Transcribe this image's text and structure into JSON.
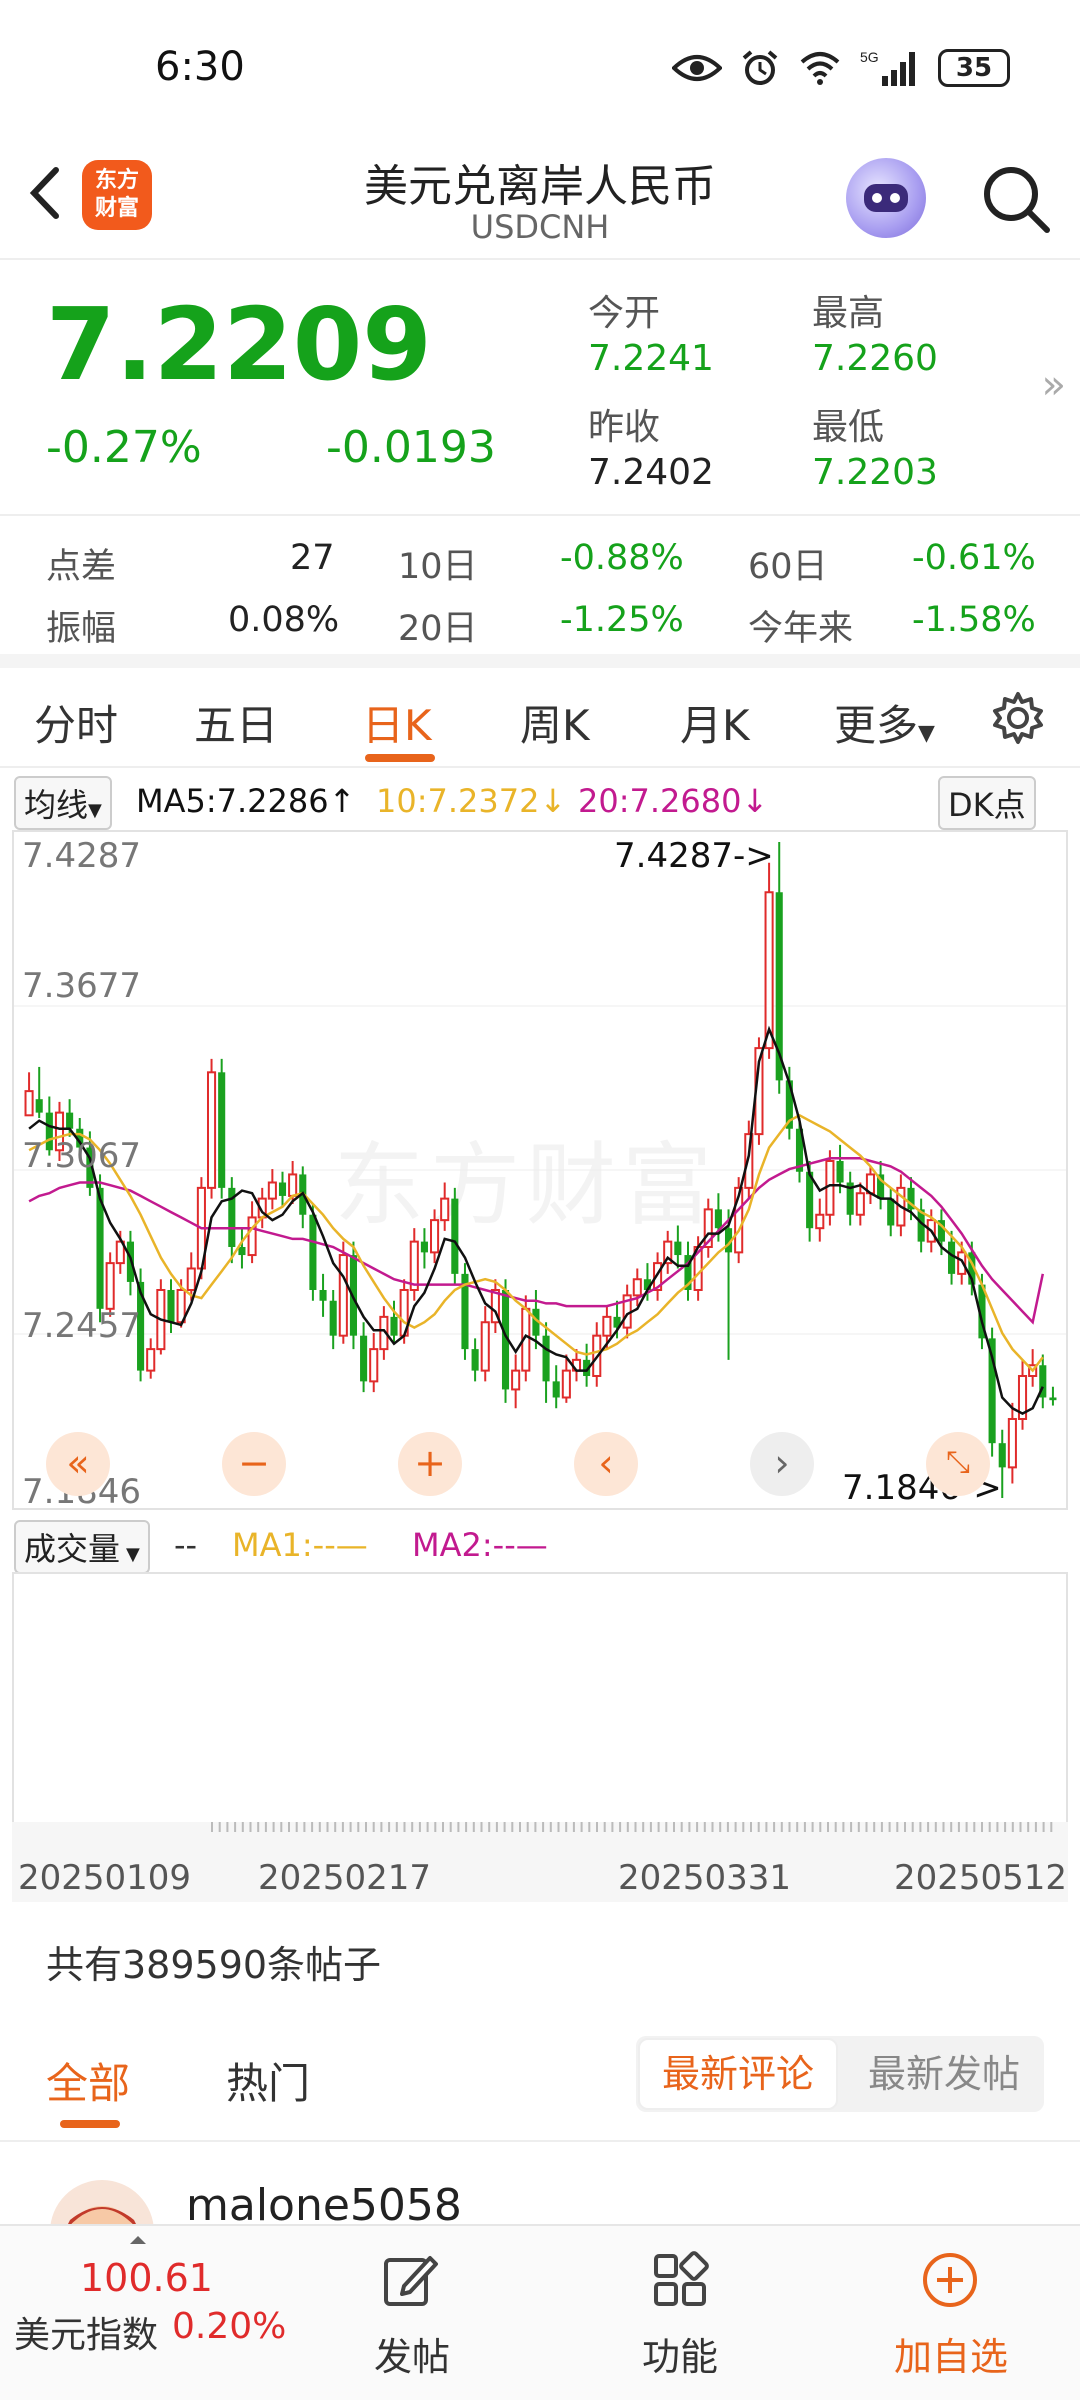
{
  "status": {
    "time": "6:30",
    "battery": "35",
    "network": "5G"
  },
  "header": {
    "title": "美元兑离岸人民币",
    "code": "USDCNH",
    "logo": [
      "东方",
      "财富"
    ]
  },
  "quote": {
    "price": "7.2209",
    "change_pct": "-0.27%",
    "change": "-0.0193",
    "open_label": "今开",
    "open": "7.2241",
    "high_label": "最高",
    "high": "7.2260",
    "prev_close_label": "昨收",
    "prev_close": "7.2402",
    "low_label": "最低",
    "low": "7.2203"
  },
  "stats": {
    "spread_label": "点差",
    "spread": "27",
    "amplitude_label": "振幅",
    "amplitude": "0.08%",
    "d10_label": "10日",
    "d10": "-0.88%",
    "d20_label": "20日",
    "d20": "-1.25%",
    "d60_label": "60日",
    "d60": "-0.61%",
    "ytd_label": "今年来",
    "ytd": "-1.58%"
  },
  "tabs": [
    "分时",
    "五日",
    "日K",
    "周K",
    "月K",
    "更多"
  ],
  "active_tab": "日K",
  "indicator": {
    "selector": "均线",
    "ma5": "MA5:7.2286↑",
    "ma10": "10:7.2372↓",
    "ma20": "20:7.2680↓",
    "dk": "DK点"
  },
  "chart_data": {
    "type": "candlestick",
    "y_ticks": [
      "7.4287",
      "7.3677",
      "7.3067",
      "7.2457",
      "7.1846"
    ],
    "ylim": [
      7.1846,
      7.4287
    ],
    "high_marker": "7.4287->",
    "low_marker": "7.1846->",
    "x_ticks": [
      "20250109",
      "20250217",
      "20250331",
      "20250512"
    ],
    "colors": {
      "up": "#e02b2b",
      "down": "#1aa11f",
      "ma5": "#111111",
      "ma10": "#e9b429",
      "ma20": "#c21a8f"
    },
    "watermark": "东方财富",
    "candles": [
      [
        7.327,
        7.336,
        7.333,
        7.343
      ],
      [
        7.333,
        7.328,
        7.326,
        7.345
      ],
      [
        7.328,
        7.314,
        7.312,
        7.334
      ],
      [
        7.314,
        7.328,
        7.31,
        7.332
      ],
      [
        7.328,
        7.322,
        7.319,
        7.333
      ],
      [
        7.322,
        7.315,
        7.312,
        7.326
      ],
      [
        7.315,
        7.3,
        7.297,
        7.321
      ],
      [
        7.3,
        7.255,
        7.25,
        7.305
      ],
      [
        7.255,
        7.272,
        7.252,
        7.276
      ],
      [
        7.272,
        7.28,
        7.268,
        7.284
      ],
      [
        7.28,
        7.265,
        7.26,
        7.284
      ],
      [
        7.265,
        7.232,
        7.228,
        7.27
      ],
      [
        7.232,
        7.24,
        7.229,
        7.244
      ],
      [
        7.24,
        7.262,
        7.238,
        7.266
      ],
      [
        7.262,
        7.25,
        7.246,
        7.266
      ],
      [
        7.25,
        7.262,
        7.248,
        7.266
      ],
      [
        7.262,
        7.27,
        7.258,
        7.276
      ],
      [
        7.27,
        7.3,
        7.266,
        7.304
      ],
      [
        7.3,
        7.343,
        7.296,
        7.348
      ],
      [
        7.343,
        7.3,
        7.296,
        7.348
      ],
      [
        7.3,
        7.278,
        7.272,
        7.304
      ],
      [
        7.278,
        7.275,
        7.27,
        7.285
      ],
      [
        7.275,
        7.289,
        7.272,
        7.295
      ],
      [
        7.289,
        7.296,
        7.285,
        7.3
      ],
      [
        7.296,
        7.302,
        7.292,
        7.307
      ],
      [
        7.302,
        7.297,
        7.293,
        7.306
      ],
      [
        7.297,
        7.305,
        7.294,
        7.31
      ],
      [
        7.305,
        7.29,
        7.285,
        7.308
      ],
      [
        7.29,
        7.262,
        7.258,
        7.294
      ],
      [
        7.262,
        7.258,
        7.252,
        7.268
      ],
      [
        7.258,
        7.245,
        7.24,
        7.262
      ],
      [
        7.245,
        7.275,
        7.242,
        7.28
      ],
      [
        7.275,
        7.245,
        7.24,
        7.28
      ],
      [
        7.245,
        7.228,
        7.224,
        7.25
      ],
      [
        7.228,
        7.24,
        7.224,
        7.246
      ],
      [
        7.24,
        7.252,
        7.236,
        7.256
      ],
      [
        7.252,
        7.245,
        7.242,
        7.258
      ],
      [
        7.245,
        7.262,
        7.242,
        7.266
      ],
      [
        7.262,
        7.28,
        7.258,
        7.285
      ],
      [
        7.28,
        7.276,
        7.27,
        7.285
      ],
      [
        7.276,
        7.288,
        7.272,
        7.292
      ],
      [
        7.288,
        7.296,
        7.284,
        7.302
      ],
      [
        7.296,
        7.268,
        7.264,
        7.3
      ],
      [
        7.268,
        7.24,
        7.236,
        7.272
      ],
      [
        7.24,
        7.232,
        7.228,
        7.244
      ],
      [
        7.232,
        7.25,
        7.228,
        7.256
      ],
      [
        7.25,
        7.262,
        7.246,
        7.266
      ],
      [
        7.262,
        7.225,
        7.22,
        7.266
      ],
      [
        7.225,
        7.232,
        7.218,
        7.238
      ],
      [
        7.232,
        7.255,
        7.228,
        7.26
      ],
      [
        7.255,
        7.245,
        7.24,
        7.262
      ],
      [
        7.245,
        7.228,
        7.22,
        7.25
      ],
      [
        7.228,
        7.222,
        7.218,
        7.234
      ],
      [
        7.222,
        7.232,
        7.22,
        7.238
      ],
      [
        7.232,
        7.236,
        7.228,
        7.24
      ],
      [
        7.236,
        7.23,
        7.226,
        7.242
      ],
      [
        7.23,
        7.245,
        7.226,
        7.25
      ],
      [
        7.245,
        7.252,
        7.24,
        7.256
      ],
      [
        7.252,
        7.248,
        7.244,
        7.258
      ],
      [
        7.248,
        7.26,
        7.244,
        7.264
      ],
      [
        7.26,
        7.266,
        7.256,
        7.27
      ],
      [
        7.266,
        7.262,
        7.258,
        7.272
      ],
      [
        7.262,
        7.272,
        7.258,
        7.276
      ],
      [
        7.272,
        7.28,
        7.268,
        7.284
      ],
      [
        7.28,
        7.275,
        7.27,
        7.286
      ],
      [
        7.275,
        7.262,
        7.258,
        7.28
      ],
      [
        7.262,
        7.278,
        7.258,
        7.282
      ],
      [
        7.278,
        7.292,
        7.274,
        7.296
      ],
      [
        7.292,
        7.285,
        7.28,
        7.298
      ],
      [
        7.285,
        7.276,
        7.236,
        7.292
      ],
      [
        7.276,
        7.3,
        7.272,
        7.304
      ],
      [
        7.3,
        7.32,
        7.296,
        7.325
      ],
      [
        7.32,
        7.352,
        7.316,
        7.356
      ],
      [
        7.352,
        7.41,
        7.348,
        7.421
      ],
      [
        7.41,
        7.34,
        7.335,
        7.4287
      ],
      [
        7.34,
        7.322,
        7.318,
        7.345
      ],
      [
        7.322,
        7.306,
        7.302,
        7.326
      ],
      [
        7.306,
        7.285,
        7.28,
        7.31
      ],
      [
        7.285,
        7.29,
        7.28,
        7.296
      ],
      [
        7.29,
        7.31,
        7.286,
        7.314
      ],
      [
        7.31,
        7.302,
        7.298,
        7.316
      ],
      [
        7.302,
        7.29,
        7.286,
        7.306
      ],
      [
        7.29,
        7.298,
        7.286,
        7.302
      ],
      [
        7.298,
        7.305,
        7.294,
        7.308
      ],
      [
        7.305,
        7.296,
        7.292,
        7.31
      ],
      [
        7.296,
        7.286,
        7.282,
        7.3
      ],
      [
        7.286,
        7.3,
        7.282,
        7.305
      ],
      [
        7.3,
        7.292,
        7.288,
        7.304
      ],
      [
        7.292,
        7.28,
        7.276,
        7.296
      ],
      [
        7.28,
        7.288,
        7.276,
        7.292
      ],
      [
        7.288,
        7.28,
        7.275,
        7.292
      ],
      [
        7.28,
        7.268,
        7.264,
        7.284
      ],
      [
        7.268,
        7.276,
        7.264,
        7.28
      ],
      [
        7.276,
        7.264,
        7.26,
        7.28
      ],
      [
        7.264,
        7.244,
        7.24,
        7.268
      ],
      [
        7.244,
        7.205,
        7.2,
        7.248
      ],
      [
        7.205,
        7.196,
        7.1846,
        7.21
      ],
      [
        7.196,
        7.214,
        7.19,
        7.22
      ],
      [
        7.214,
        7.23,
        7.21,
        7.236
      ],
      [
        7.23,
        7.234,
        7.226,
        7.24
      ],
      [
        7.234,
        7.222,
        7.218,
        7.238
      ],
      [
        7.222,
        7.221,
        7.219,
        7.226
      ]
    ],
    "ma5": [
      7.322,
      7.325,
      7.323,
      7.322,
      7.322,
      7.317,
      7.311,
      7.296,
      7.287,
      7.281,
      7.274,
      7.261,
      7.253,
      7.251,
      7.25,
      7.249,
      7.257,
      7.269,
      7.289,
      7.295,
      7.296,
      7.299,
      7.298,
      7.291,
      7.288,
      7.29,
      7.295,
      7.298,
      7.291,
      7.282,
      7.272,
      7.267,
      7.259,
      7.252,
      7.247,
      7.247,
      7.242,
      7.245,
      7.256,
      7.261,
      7.27,
      7.281,
      7.28,
      7.274,
      7.265,
      7.257,
      7.254,
      7.245,
      7.239,
      7.245,
      7.243,
      7.24,
      7.238,
      7.237,
      7.232,
      7.232,
      7.237,
      7.242,
      7.247,
      7.253,
      7.255,
      7.262,
      7.268,
      7.274,
      7.271,
      7.271,
      7.278,
      7.283,
      7.283,
      7.286,
      7.297,
      7.312,
      7.347,
      7.359,
      7.35,
      7.339,
      7.325,
      7.305,
      7.299,
      7.301,
      7.301,
      7.3,
      7.301,
      7.298,
      7.296,
      7.296,
      7.293,
      7.291,
      7.287,
      7.284,
      7.278,
      7.275,
      7.273,
      7.266,
      7.25,
      7.237,
      7.222,
      7.218,
      7.216,
      7.218,
      7.226
    ],
    "ma10": [
      7.314,
      7.316,
      7.318,
      7.319,
      7.32,
      7.32,
      7.318,
      7.314,
      7.309,
      7.303,
      7.297,
      7.29,
      7.282,
      7.274,
      7.268,
      7.263,
      7.26,
      7.259,
      7.264,
      7.269,
      7.274,
      7.28,
      7.285,
      7.289,
      7.291,
      7.293,
      7.297,
      7.298,
      7.294,
      7.29,
      7.285,
      7.281,
      7.278,
      7.271,
      7.265,
      7.259,
      7.254,
      7.25,
      7.248,
      7.25,
      7.253,
      7.258,
      7.262,
      7.264,
      7.265,
      7.266,
      7.265,
      7.262,
      7.258,
      7.255,
      7.251,
      7.248,
      7.245,
      7.242,
      7.239,
      7.238,
      7.239,
      7.24,
      7.242,
      7.245,
      7.247,
      7.25,
      7.253,
      7.257,
      7.261,
      7.264,
      7.268,
      7.272,
      7.276,
      7.279,
      7.284,
      7.292,
      7.305,
      7.315,
      7.32,
      7.325,
      7.327,
      7.325,
      7.323,
      7.321,
      7.318,
      7.315,
      7.312,
      7.308,
      7.303,
      7.3,
      7.297,
      7.294,
      7.291,
      7.289,
      7.286,
      7.282,
      7.278,
      7.272,
      7.264,
      7.255,
      7.246,
      7.24,
      7.236,
      7.232,
      7.237
    ],
    "ma20": [
      7.295,
      7.297,
      7.298,
      7.3,
      7.301,
      7.302,
      7.302,
      7.302,
      7.301,
      7.3,
      7.299,
      7.297,
      7.295,
      7.293,
      7.291,
      7.289,
      7.287,
      7.285,
      7.285,
      7.285,
      7.285,
      7.285,
      7.285,
      7.284,
      7.283,
      7.282,
      7.281,
      7.281,
      7.28,
      7.279,
      7.278,
      7.276,
      7.274,
      7.272,
      7.27,
      7.268,
      7.266,
      7.265,
      7.264,
      7.264,
      7.264,
      7.264,
      7.264,
      7.264,
      7.263,
      7.262,
      7.261,
      7.26,
      7.259,
      7.258,
      7.258,
      7.257,
      7.257,
      7.256,
      7.256,
      7.256,
      7.256,
      7.256,
      7.257,
      7.258,
      7.259,
      7.261,
      7.263,
      7.266,
      7.269,
      7.272,
      7.276,
      7.28,
      7.284,
      7.288,
      7.292,
      7.296,
      7.3,
      7.303,
      7.305,
      7.307,
      7.308,
      7.309,
      7.31,
      7.311,
      7.311,
      7.311,
      7.311,
      7.31,
      7.309,
      7.308,
      7.306,
      7.303,
      7.3,
      7.297,
      7.293,
      7.288,
      7.283,
      7.277,
      7.271,
      7.266,
      7.262,
      7.258,
      7.254,
      7.25,
      7.268
    ]
  },
  "volume": {
    "selector": "成交量",
    "value": "--",
    "ma1": "MA1:--",
    "ma2": "MA2:--"
  },
  "posts": {
    "count_text": "共有389590条帖子",
    "tabs": [
      "全部",
      "热门"
    ],
    "sort_active": "最新评论",
    "sort_other": "最新发帖",
    "first_user": "malone5058"
  },
  "bottom": {
    "index_value": "100.61",
    "index_name": "美元指数",
    "index_pct": "0.20%",
    "post": "发帖",
    "function": "功能",
    "add": "加自选"
  }
}
